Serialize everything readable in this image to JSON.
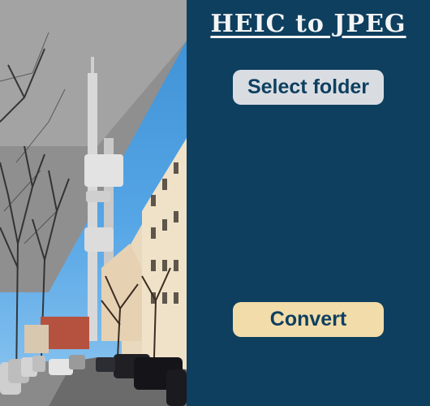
{
  "window": {
    "title": "HEIC to JPEG"
  },
  "buttons": {
    "select_folder_label": "Select folder",
    "convert_label": "Convert"
  },
  "colors": {
    "panel_background": "#0e3f5f",
    "title_text": "#f4f4f4",
    "select_button_bg": "#d9dde2",
    "convert_button_bg": "#f2dcaa",
    "button_text": "#0e3f5f"
  },
  "image": {
    "description_icon": "city-street-tv-tower-photo"
  }
}
